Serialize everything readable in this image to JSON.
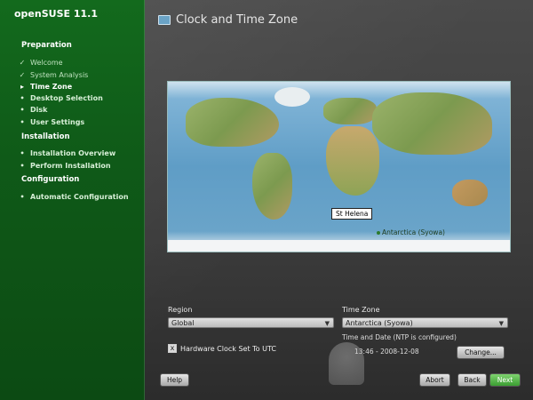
{
  "app": {
    "brand": "openSUSE 11.1"
  },
  "sidebar": {
    "sections": [
      {
        "title": "Preparation",
        "steps": [
          {
            "label": "Welcome",
            "state": "done"
          },
          {
            "label": "System Analysis",
            "state": "done"
          },
          {
            "label": "Time Zone",
            "state": "current"
          },
          {
            "label": "Desktop Selection",
            "state": "todo"
          },
          {
            "label": "Disk",
            "state": "todo"
          },
          {
            "label": "User Settings",
            "state": "todo"
          }
        ]
      },
      {
        "title": "Installation",
        "steps": [
          {
            "label": "Installation Overview",
            "state": "todo"
          },
          {
            "label": "Perform Installation",
            "state": "todo"
          }
        ]
      },
      {
        "title": "Configuration",
        "steps": [
          {
            "label": "Automatic Configuration",
            "state": "todo"
          }
        ]
      }
    ]
  },
  "main": {
    "title": "Clock and Time Zone",
    "map": {
      "callout": "St Helena",
      "selected_label": "Antarctica (Syowa)"
    },
    "form": {
      "region_label": "Region",
      "region_value": "Global",
      "timezone_label": "Time Zone",
      "timezone_value": "Antarctica (Syowa)",
      "time_status": "Time and Date (NTP is configured)",
      "datetime": "13:46 - 2008-12-08",
      "hardware_clock_label": "Hardware Clock Set To UTC",
      "hardware_clock_checked": "x",
      "change_button": "Change..."
    },
    "buttons": {
      "help": "Help",
      "abort": "Abort",
      "back": "Back",
      "next": "Next"
    }
  }
}
